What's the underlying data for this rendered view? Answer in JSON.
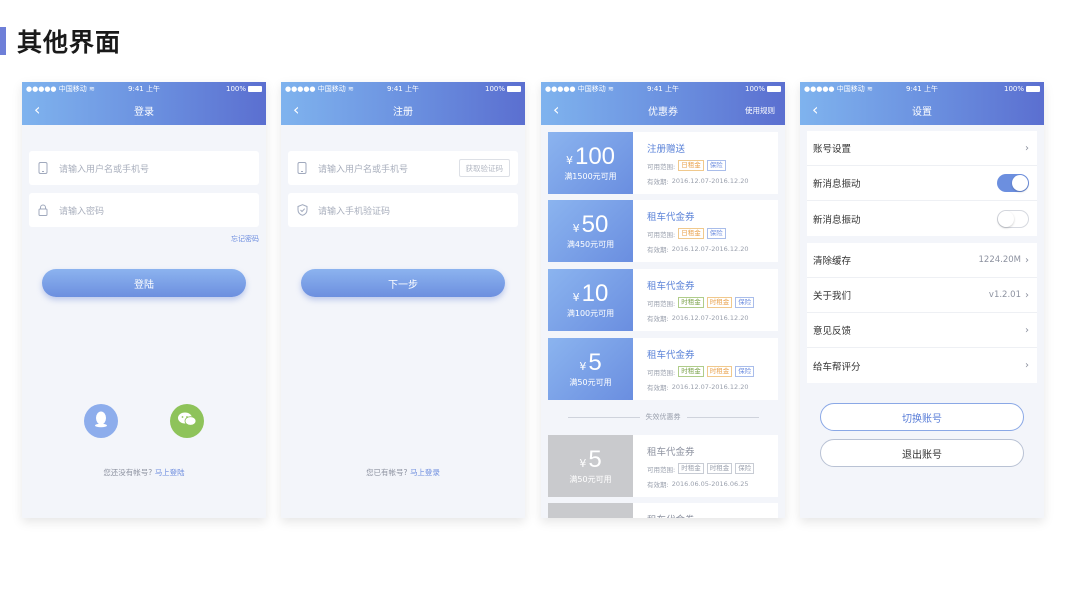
{
  "heading": "其他界面",
  "status": {
    "carrier": "●●●●● 中国移动 ≋",
    "time": "9:41 上午",
    "battery": "100%"
  },
  "login": {
    "title": "登录",
    "username_placeholder": "请输入用户名或手机号",
    "password_placeholder": "请输入密码",
    "forgot": "忘记密码",
    "submit": "登陆",
    "no_account": "您还没有帐号?",
    "register_link": "马上登陆"
  },
  "register": {
    "title": "注册",
    "username_placeholder": "请输入用户名或手机号",
    "get_code": "获取验证码",
    "code_placeholder": "请输入手机验证码",
    "next": "下一步",
    "have_account": "您已有帐号?",
    "login_link": "马上登录"
  },
  "coupons": {
    "title": "优惠券",
    "rules": "使用规则",
    "scope_label": "可用范围:",
    "expiry_label": "有效期:",
    "currency": "¥",
    "invalid_divider": "失效优惠券",
    "items": [
      {
        "value": "100",
        "condition": "满1500元可用",
        "name": "注册赠送",
        "tags": [
          {
            "text": "日租金",
            "color": "orange"
          },
          {
            "text": "保险",
            "color": "blue"
          }
        ],
        "expiry": "2016.12.07-2016.12.20"
      },
      {
        "value": "50",
        "condition": "满450元可用",
        "name": "租车代金券",
        "tags": [
          {
            "text": "日租金",
            "color": "orange"
          },
          {
            "text": "保险",
            "color": "blue"
          }
        ],
        "expiry": "2016.12.07-2016.12.20"
      },
      {
        "value": "10",
        "condition": "满100元可用",
        "name": "租车代金券",
        "tags": [
          {
            "text": "时租金",
            "color": "green"
          },
          {
            "text": "时租金",
            "color": "orange"
          },
          {
            "text": "保险",
            "color": "blue"
          }
        ],
        "expiry": "2016.12.07-2016.12.20"
      },
      {
        "value": "5",
        "condition": "满50元可用",
        "name": "租车代金券",
        "tags": [
          {
            "text": "时租金",
            "color": "green"
          },
          {
            "text": "时租金",
            "color": "orange"
          },
          {
            "text": "保险",
            "color": "blue"
          }
        ],
        "expiry": "2016.12.07-2016.12.20"
      }
    ],
    "invalid": [
      {
        "value": "5",
        "condition": "满50元可用",
        "name": "租车代金券",
        "tags": [
          {
            "text": "时租金",
            "color": "gray"
          },
          {
            "text": "时租金",
            "color": "gray"
          },
          {
            "text": "保险",
            "color": "gray"
          }
        ],
        "expiry": "2016.06.05-2016.06.25"
      },
      {
        "value": "",
        "condition": "",
        "name": "租车代金券",
        "tags": [],
        "expiry": ""
      }
    ]
  },
  "settings": {
    "title": "设置",
    "account_settings": "账号设置",
    "vibrate_1": "新消息振动",
    "vibrate_1_on": true,
    "vibrate_2": "新消息振动",
    "vibrate_2_on": false,
    "clear_cache": "清除缓存",
    "cache_size": "1224.20M",
    "about": "关于我们",
    "version": "v1.2.01",
    "feedback": "意见反馈",
    "rate": "给车帮评分",
    "switch_account": "切换账号",
    "logout": "退出账号"
  },
  "colors": {
    "accent": "#6c8fdf",
    "header_start": "#7fb3ee",
    "header_end": "#5b6fd0",
    "qq": "#8dadec",
    "wechat": "#8ec35a"
  }
}
